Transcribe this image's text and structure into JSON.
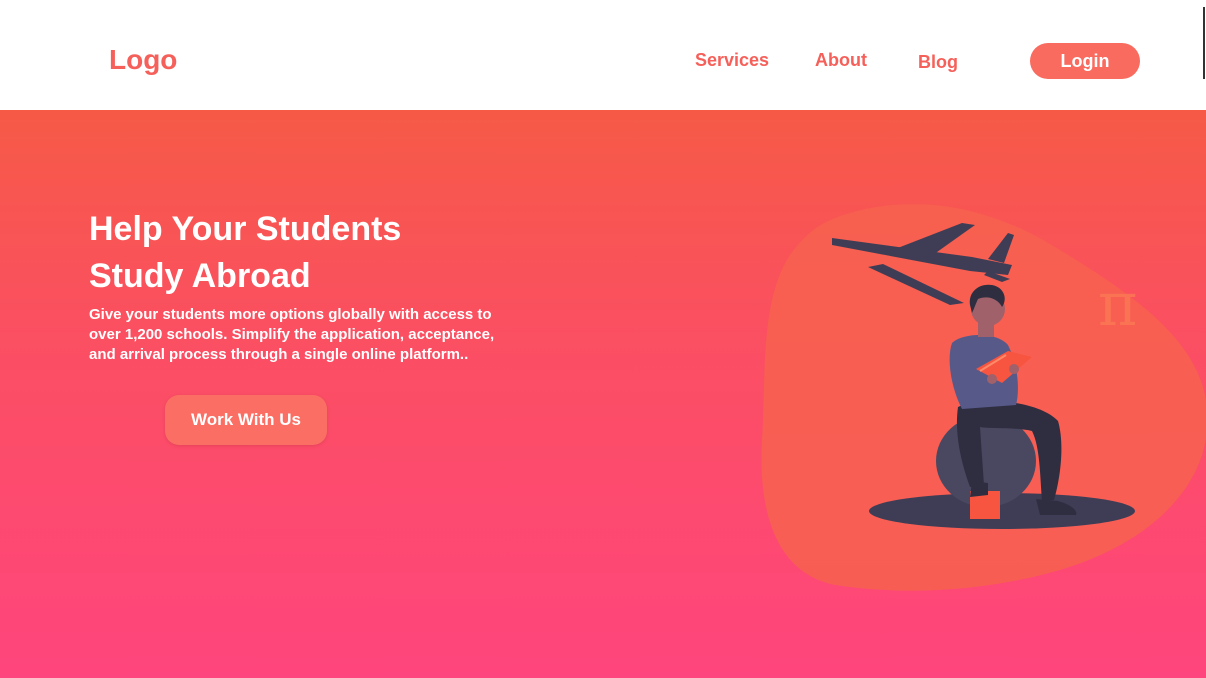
{
  "header": {
    "logo": "Logo",
    "nav": [
      "Services",
      "About",
      "Blog"
    ],
    "login_label": "Login"
  },
  "hero": {
    "title_line1": "Help Your Students",
    "title_line2": "Study Abroad",
    "description": "Give your students more options globally with access to over 1,200 schools. Simplify the application, acceptance, and arrival process through a single online platform..",
    "cta_label": "Work With Us"
  },
  "illustration": {
    "symbol": "π",
    "icons": [
      "airplane-icon",
      "student-reading-figure"
    ]
  },
  "colors": {
    "brand": "#f6605a",
    "gradient_top": "#f65a46",
    "gradient_bottom": "#ff457d",
    "button": "#fb6e63"
  }
}
